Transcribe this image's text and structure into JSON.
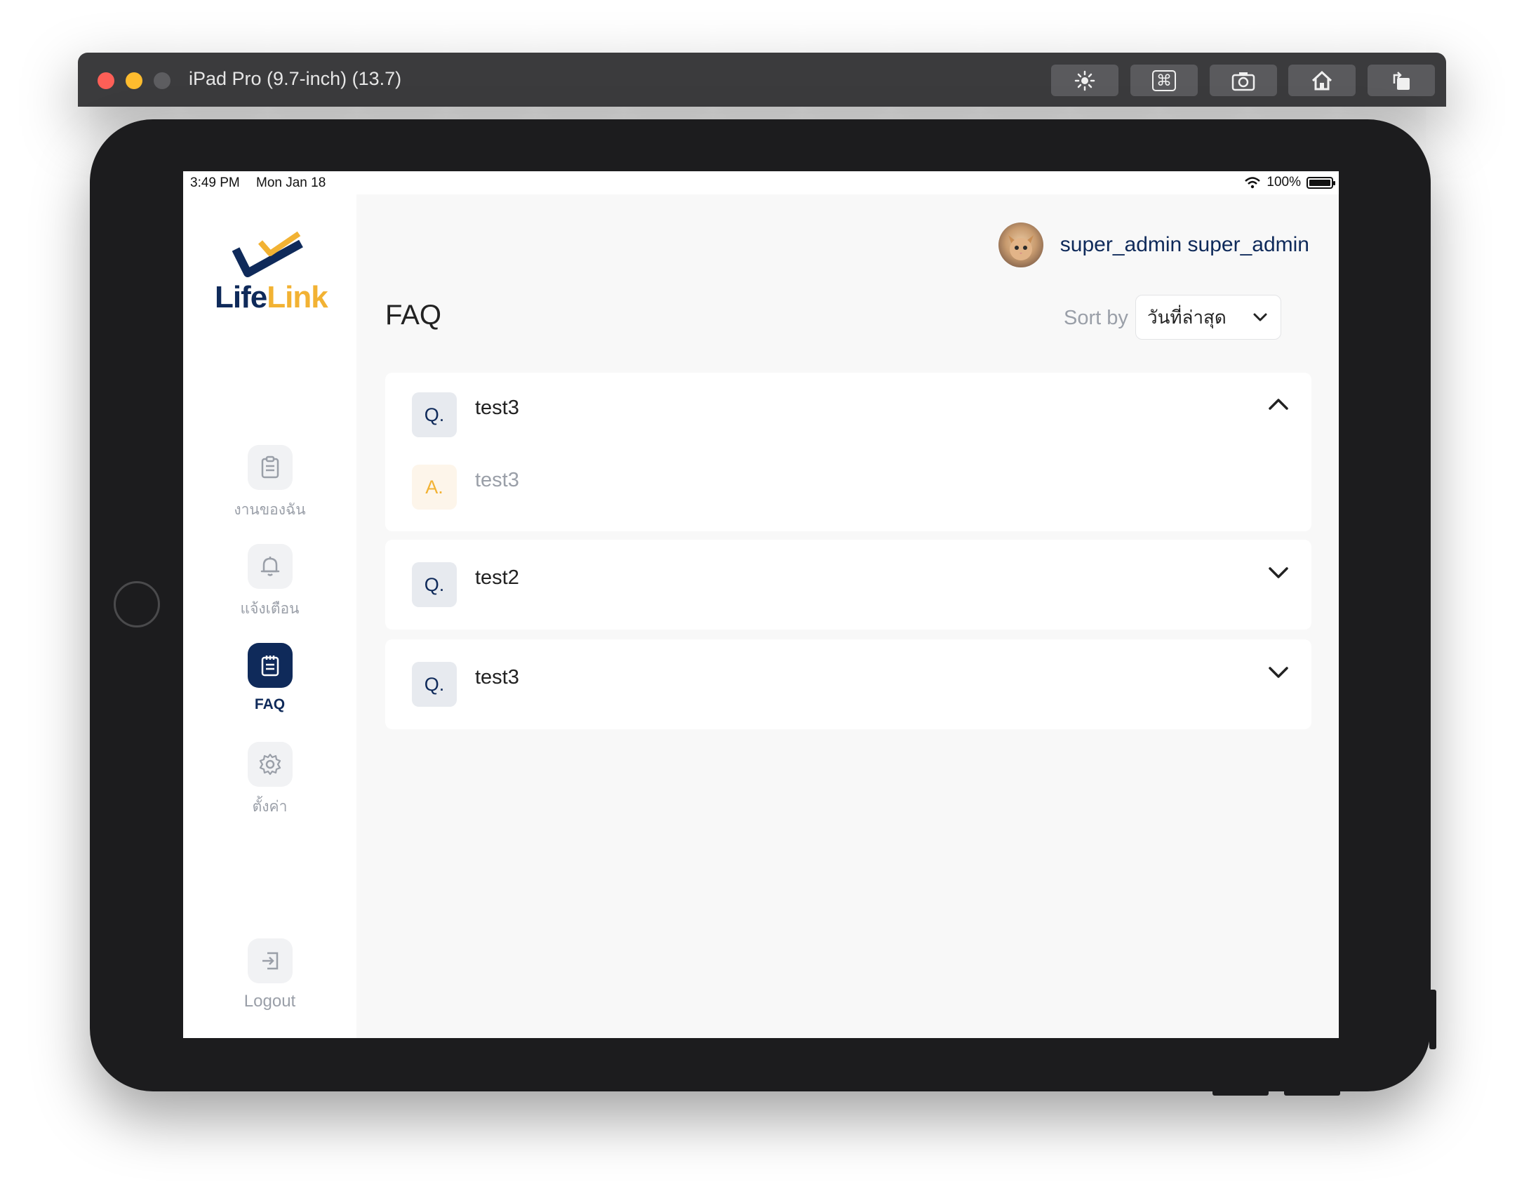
{
  "simulator": {
    "title": "iPad Pro (9.7-inch) (13.7)",
    "buttons": [
      "brightness-icon",
      "command-icon",
      "screenshot-icon",
      "home-icon",
      "rotate-icon"
    ]
  },
  "status_bar": {
    "time": "3:49 PM",
    "date": "Mon Jan 18",
    "battery": "100%"
  },
  "logo": {
    "life": "Life",
    "link": "Link"
  },
  "sidebar": {
    "items": [
      {
        "label": "งานของฉัน",
        "icon": "clipboard-icon",
        "active": false
      },
      {
        "label": "แจ้งเตือน",
        "icon": "bell-icon",
        "active": false
      },
      {
        "label": "FAQ",
        "icon": "notepad-icon",
        "active": true
      },
      {
        "label": "ตั้งค่า",
        "icon": "gear-icon",
        "active": false
      }
    ],
    "logout": "Logout"
  },
  "header": {
    "user_name": "super_admin super_admin"
  },
  "page": {
    "title": "FAQ",
    "sort_label": "Sort by",
    "sort_value": "วันที่ล่าสุด"
  },
  "faq": [
    {
      "q_badge": "Q.",
      "question": "test3",
      "a_badge": "A.",
      "answer": "test3",
      "expanded": true
    },
    {
      "q_badge": "Q.",
      "question": "test2",
      "expanded": false
    },
    {
      "q_badge": "Q.",
      "question": "test3",
      "expanded": false
    }
  ],
  "colors": {
    "brand_navy": "#0f2a5a",
    "brand_yellow": "#f2b233",
    "muted_text": "#9a9fa8"
  }
}
